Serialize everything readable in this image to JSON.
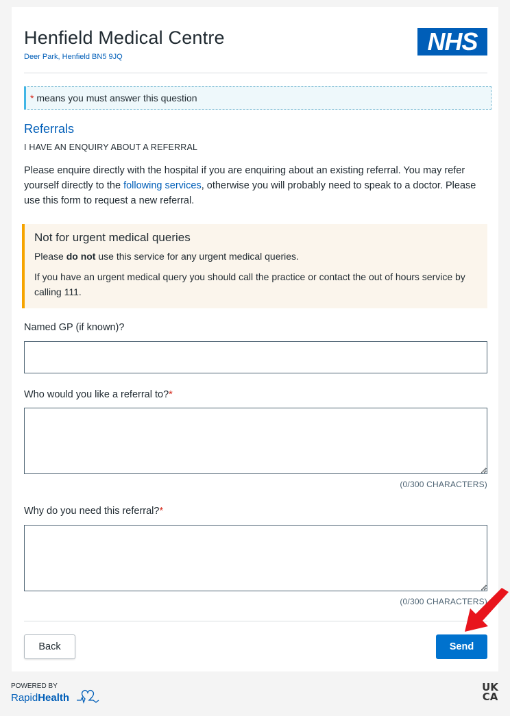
{
  "header": {
    "title": "Henfield Medical Centre",
    "address": "Deer Park, Henfield BN5 9JQ",
    "logo_text": "NHS"
  },
  "notice": {
    "marker": "*",
    "text": " means you must answer this question"
  },
  "section": {
    "title": "Referrals",
    "subtitle": "I HAVE AN ENQUIRY ABOUT A REFERRAL",
    "intro_before_link": "Please enquire directly with the hospital if you are enquiring about an existing referral. You may refer yourself directly to the ",
    "intro_link": "following services",
    "intro_after_link": ", otherwise you will probably need to speak to a doctor. Please use this form to request a new referral."
  },
  "warning": {
    "title": "Not for urgent medical queries",
    "line1_before": "Please ",
    "line1_bold": "do not",
    "line1_after": " use this service for any urgent medical queries.",
    "line2": "If you have an urgent medical query you should call the practice or contact the out of hours service by calling 111."
  },
  "form": {
    "fields": [
      {
        "label": "Named GP (if known)?",
        "required": false,
        "value": ""
      },
      {
        "label": "Who would you like a referral to?",
        "required": true,
        "value": "",
        "counter": "(0/300 CHARACTERS)"
      },
      {
        "label": "Why do you need this referral?",
        "required": true,
        "value": "",
        "counter": "(0/300 CHARACTERS)"
      }
    ],
    "required_marker": "*"
  },
  "actions": {
    "back_label": "Back",
    "send_label": "Send"
  },
  "footer": {
    "powered_by": "POWERED BY",
    "brand_light": "Rapid",
    "brand_bold": "Health",
    "ukca_top": "UK",
    "ukca_bottom": "CA"
  },
  "colors": {
    "nhs_blue": "#005eb8",
    "button_blue": "#0072ce",
    "warning_accent": "#f6a400",
    "required_red": "#d5281b",
    "arrow_red": "#e8141c"
  },
  "icons": [
    "nhs-logo",
    "rapid-health-heart-icon",
    "ukca-mark",
    "pointer-arrow-icon",
    "resize-grip-icon"
  ]
}
